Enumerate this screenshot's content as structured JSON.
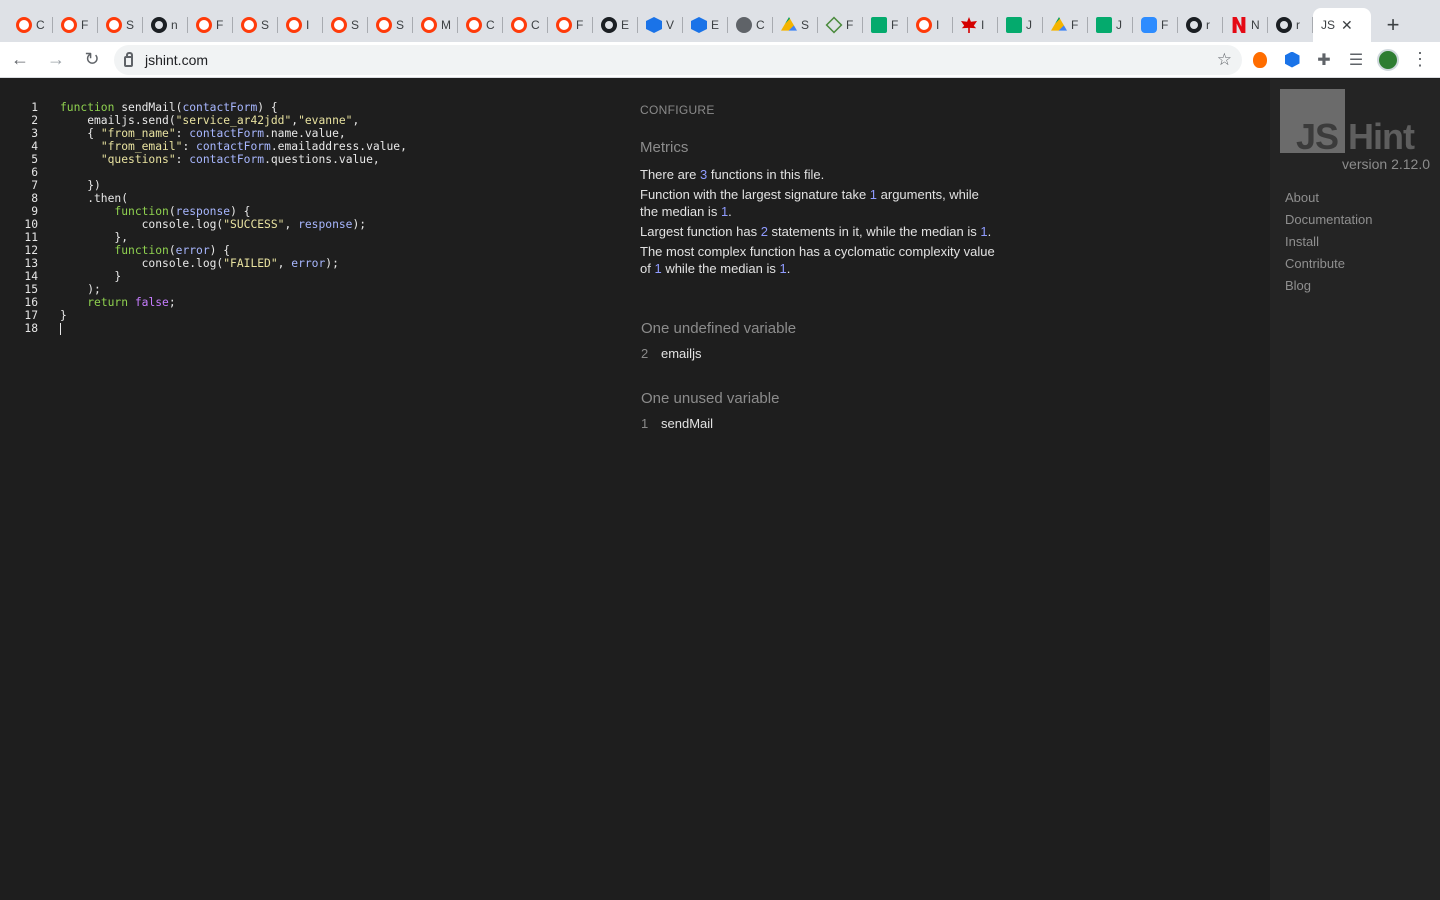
{
  "browser": {
    "tabs": [
      {
        "icon": "ring-icon",
        "label": "C"
      },
      {
        "icon": "ring-icon",
        "label": "F"
      },
      {
        "icon": "ring-icon",
        "label": "S"
      },
      {
        "icon": "github-icon",
        "label": "n"
      },
      {
        "icon": "ring-icon",
        "label": "F"
      },
      {
        "icon": "ring-icon",
        "label": "S"
      },
      {
        "icon": "ring-icon",
        "label": "I"
      },
      {
        "icon": "ring-icon",
        "label": "S"
      },
      {
        "icon": "ring-icon",
        "label": "S"
      },
      {
        "icon": "ring-icon",
        "label": "M"
      },
      {
        "icon": "ring-icon",
        "label": "C"
      },
      {
        "icon": "ring-icon",
        "label": "C"
      },
      {
        "icon": "ring-icon",
        "label": "F"
      },
      {
        "icon": "github-icon",
        "label": "E"
      },
      {
        "icon": "hex-icon",
        "label": "V"
      },
      {
        "icon": "hex-icon",
        "label": "E"
      },
      {
        "icon": "globe-icon",
        "label": "C"
      },
      {
        "icon": "drive-icon",
        "label": "S"
      },
      {
        "icon": "diamond-icon",
        "label": "F"
      },
      {
        "icon": "w3-icon",
        "label": "F"
      },
      {
        "icon": "ring-icon",
        "label": "I"
      },
      {
        "icon": "maple-leaf-icon",
        "label": "I"
      },
      {
        "icon": "w3-icon",
        "label": "J"
      },
      {
        "icon": "drive-icon",
        "label": "F"
      },
      {
        "icon": "w3-icon",
        "label": "J"
      },
      {
        "icon": "zoom-icon",
        "label": "F"
      },
      {
        "icon": "github-icon",
        "label": "r"
      },
      {
        "icon": "netflix-icon",
        "label": "N"
      },
      {
        "icon": "github-icon",
        "label": "r"
      }
    ],
    "active_tab": {
      "label": "JS",
      "close": "✕"
    },
    "new_tab": "+",
    "url": "jshint.com",
    "nav": {
      "back": "←",
      "forward": "→",
      "reload": "↻"
    },
    "star": "☆"
  },
  "editor": {
    "lines": [
      {
        "n": "1"
      },
      {
        "n": "2"
      },
      {
        "n": "3"
      },
      {
        "n": "4"
      },
      {
        "n": "5"
      },
      {
        "n": "6"
      },
      {
        "n": "7"
      },
      {
        "n": "8"
      },
      {
        "n": "9"
      },
      {
        "n": "10"
      },
      {
        "n": "11"
      },
      {
        "n": "12"
      },
      {
        "n": "13"
      },
      {
        "n": "14"
      },
      {
        "n": "15"
      },
      {
        "n": "16"
      },
      {
        "n": "17"
      },
      {
        "n": "18"
      }
    ],
    "code": {
      "l1_kw": "function",
      "l1_rest_a": " sendMail(",
      "l1_param": "contactForm",
      "l1_rest_b": ") {",
      "l2_a": "    emailjs.send(",
      "l2_s1": "\"service_ar42jdd\"",
      "l2_comma": ",",
      "l2_s2": "\"evanne\"",
      "l2_end": ",",
      "l3_a": "    { ",
      "l3_key": "\"from_name\"",
      "l3_colon": ": ",
      "l3_var": "contactForm",
      "l3_rest": ".name.value,",
      "l4_a": "      ",
      "l4_key": "\"from_email\"",
      "l4_colon": ": ",
      "l4_var": "contactForm",
      "l4_rest": ".emailaddress.value,",
      "l5_a": "      ",
      "l5_key": "\"questions\"",
      "l5_colon": ": ",
      "l5_var": "contactForm",
      "l5_rest": ".questions.value,",
      "l6": "",
      "l7": "    })",
      "l8": "    .then(",
      "l9_a": "        ",
      "l9_kw": "function",
      "l9_b": "(",
      "l9_param": "response",
      "l9_c": ") {",
      "l10_a": "            console.log(",
      "l10_s": "\"SUCCESS\"",
      "l10_b": ", ",
      "l10_var": "response",
      "l10_c": ");",
      "l11": "        },",
      "l12_a": "        ",
      "l12_kw": "function",
      "l12_b": "(",
      "l12_param": "error",
      "l12_c": ") {",
      "l13_a": "            console.log(",
      "l13_s": "\"FAILED\"",
      "l13_b": ", ",
      "l13_var": "error",
      "l13_c": ");",
      "l14": "        }",
      "l15": "    );",
      "l16_a": "    ",
      "l16_kw": "return",
      "l16_b": " ",
      "l16_false": "false",
      "l16_c": ";",
      "l17": "}"
    }
  },
  "report": {
    "configure": "CONFIGURE",
    "metrics_heading": "Metrics",
    "m1": {
      "a": "There are ",
      "n": "3",
      "b": " functions in this file."
    },
    "m2": {
      "a": "Function with the largest signature take ",
      "n1": "1",
      "b": " arguments, while the median is ",
      "n2": "1",
      "c": "."
    },
    "m3": {
      "a": "Largest function has ",
      "n1": "2",
      "b": " statements in it, while the median is ",
      "n2": "1",
      "c": "."
    },
    "m4": {
      "a": "The most complex function has a cyclomatic complexity value of ",
      "n1": "1",
      "b": " while the median is ",
      "n2": "1",
      "c": "."
    },
    "undefined_heading": "One undefined variable",
    "undefined": {
      "line": "2",
      "name": "emailjs"
    },
    "unused_heading": "One unused variable",
    "unused": {
      "line": "1",
      "name": "sendMail"
    }
  },
  "sidebar": {
    "logo_js": "JS",
    "logo_hint": "Hint",
    "version": "version 2.12.0",
    "links": [
      "About",
      "Documentation",
      "Install",
      "Contribute",
      "Blog"
    ]
  }
}
